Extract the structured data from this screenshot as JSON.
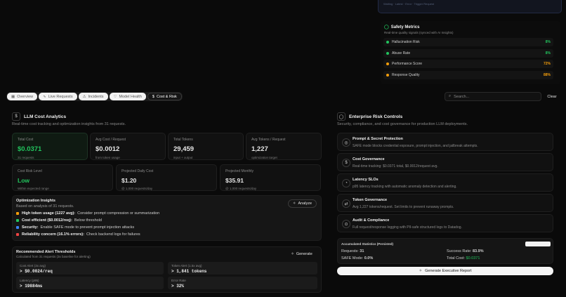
{
  "top_panel": {
    "note": "Waiting · Latest · Error · Trigger Request"
  },
  "safety": {
    "title": "Safety Metrics",
    "subtitle": "Real-time quality signals (synced with AI Insights)",
    "metrics": [
      {
        "label": "Hallucination Risk",
        "value": "8%",
        "color": "#22c55e"
      },
      {
        "label": "Abuse Rate",
        "value": "8%",
        "color": "#22c55e"
      },
      {
        "label": "Performance Score",
        "value": "72%",
        "color": "#f59e0b"
      },
      {
        "label": "Response Quality",
        "value": "88%",
        "color": "#f59e0b"
      }
    ]
  },
  "tabs": [
    {
      "label": "Overview",
      "icon": "▦"
    },
    {
      "label": "Live Requests",
      "icon": "∿"
    },
    {
      "label": "Incidents",
      "icon": "⚠"
    },
    {
      "label": "Model Health",
      "icon": "♡"
    },
    {
      "label": "Cost & Risk",
      "icon": "$"
    }
  ],
  "search": {
    "placeholder": "Search...",
    "clear_label": "Clear"
  },
  "cost": {
    "title": "LLM Cost Analytics",
    "subtitle": "Real-time cost tracking and optimization insights from 31 requests.",
    "stats": [
      {
        "label": "Total Cost",
        "value": "$0.0371",
        "sub": "31 requests"
      },
      {
        "label": "Avg Cost / Request",
        "value": "$0.0012",
        "sub": "from token usage"
      },
      {
        "label": "Total Tokens",
        "value": "29,459",
        "sub": "input + output"
      },
      {
        "label": "Avg Tokens / Request",
        "value": "1,227",
        "sub": "optimization target"
      }
    ],
    "row2": [
      {
        "label": "Cost Risk Level",
        "value": "Low",
        "sub": "Within expected range"
      },
      {
        "label": "Projected Daily Cost",
        "value": "$1.20",
        "sub": "@ 1,000 requests/day"
      },
      {
        "label": "Projected Monthly",
        "value": "$35.91",
        "sub": "@ 1,000 requests/day"
      }
    ]
  },
  "insights": {
    "title": "Optimization Insights",
    "subtitle": "Based on analysis of 31 requests.",
    "analyze_label": "Analyze",
    "items": [
      {
        "bold": "High token usage (1227 avg):",
        "text": "Consider prompt compression or summarization",
        "color": "#f59e0b"
      },
      {
        "bold": "Cost efficient ($0.0012/req):",
        "text": "Below threshold",
        "color": "#22c55e"
      },
      {
        "bold": "Security:",
        "text": "Enable SAFE mode to prevent prompt injection attacks",
        "color": "#3b82f6"
      },
      {
        "bold": "Reliability concern (16.1% errors):",
        "text": "Check backend logs for failures",
        "color": "#ef4444"
      }
    ]
  },
  "thresholds": {
    "title": "Recommended Alert Thresholds",
    "subtitle": "Calculated from 31 requests (3x baseline for alerting)",
    "generate_label": "Generate",
    "items": [
      {
        "label": "Cost Alert (3x avg)",
        "value": "> $0.0024/req"
      },
      {
        "label": "Token Alert (1.5x avg)",
        "value": "> 1,841 tokens"
      },
      {
        "label": "Latency (p95)",
        "value": "> 19884ms"
      },
      {
        "label": "Error Rate",
        "value": "> 32%"
      }
    ]
  },
  "risk": {
    "title": "Enterprise Risk Controls",
    "subtitle": "Security, compliance, and cost governance for production LLM deployments.",
    "items": [
      {
        "icon": "◎",
        "title": "Prompt & Secret Protection",
        "desc": "SAFE mode blocks credential exposure, prompt injection, and jailbreak attempts."
      },
      {
        "icon": "$",
        "title": "Cost Governance",
        "desc": "Real-time tracking: $0.0371 total, $0.0012/request avg."
      },
      {
        "icon": "◔",
        "title": "Latency SLOs",
        "desc": "p95 latency tracking with automatic anomaly detection and alerting."
      },
      {
        "icon": "⇄",
        "title": "Token Governance",
        "desc": "Avg 1,227 tokens/request. Set limits to prevent runaway prompts."
      },
      {
        "icon": "⊙",
        "title": "Audit & Compliance",
        "desc": "Full request/response logging with PII-safe structured logs to Datadog."
      }
    ]
  },
  "accumulated": {
    "title": "Accumulated Statistics (Persisted)",
    "requests_label": "Requests:",
    "requests_value": "31",
    "success_label": "Success Rate:",
    "success_value": "83.9%",
    "safe_label": "SAFE Mode:",
    "safe_value": "0.0%",
    "cost_label": "Total Cost:",
    "cost_value": "$0.0371"
  },
  "report": {
    "label": "Generate Executive Report"
  }
}
